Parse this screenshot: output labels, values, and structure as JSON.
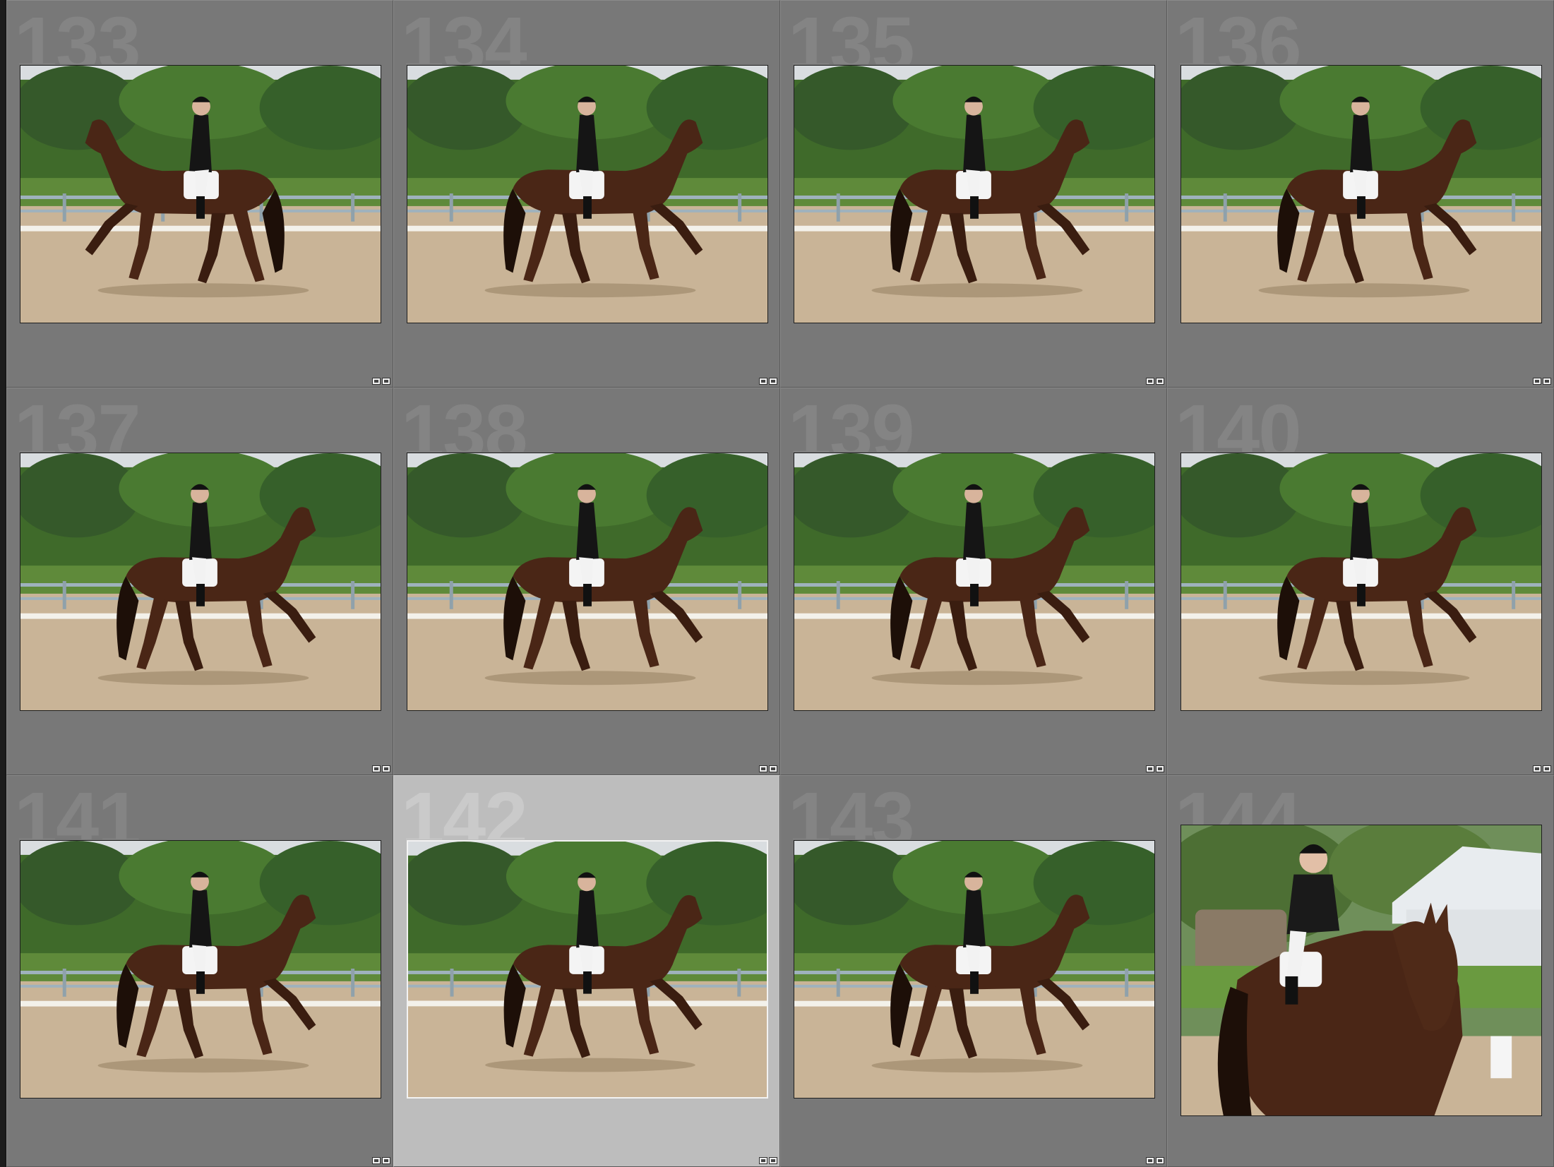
{
  "filmstrip": {
    "cells": [
      {
        "number": "133",
        "selected": false,
        "view": "left"
      },
      {
        "number": "134",
        "selected": false,
        "view": "right"
      },
      {
        "number": "135",
        "selected": false,
        "view": "right"
      },
      {
        "number": "136",
        "selected": false,
        "view": "right"
      },
      {
        "number": "137",
        "selected": false,
        "view": "right"
      },
      {
        "number": "138",
        "selected": false,
        "view": "right"
      },
      {
        "number": "139",
        "selected": false,
        "view": "right"
      },
      {
        "number": "140",
        "selected": false,
        "view": "right"
      },
      {
        "number": "141",
        "selected": false,
        "view": "right"
      },
      {
        "number": "142",
        "selected": true,
        "view": "right"
      },
      {
        "number": "143",
        "selected": false,
        "view": "right"
      },
      {
        "number": "144",
        "selected": false,
        "view": "front"
      }
    ]
  },
  "colors": {
    "cell_background": "#787878",
    "selected_cell_background": "#bdbdbd",
    "horse": "#4a2616",
    "foliage": "#3f6a2a",
    "arena_sand": "#c9b497"
  }
}
